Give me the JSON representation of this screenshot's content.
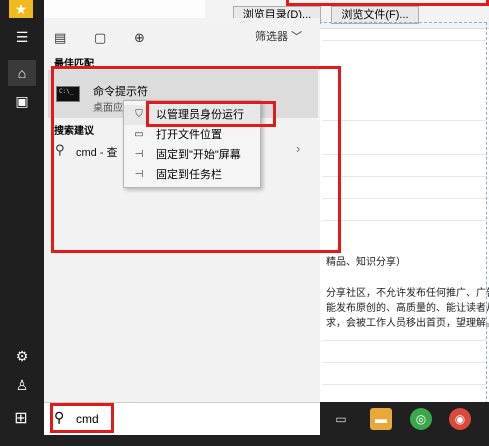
{
  "background": {
    "buttons": [
      "浏览目录(D)...",
      "浏览文件(F)..."
    ],
    "text_lines": [
      "精品、知识分享）",
      "分享社区，不允许发布任何推广、广告、",
      "能发布原创的、高质量的、能让读者从",
      "求，会被工作人员移出首页，望理解。如"
    ]
  },
  "panel": {
    "filter_label": "筛选器",
    "best_match_label": "最佳匹配",
    "best_match": {
      "title": "命令提示符",
      "subtitle": "桌面应用",
      "icon_text": "C:\\_"
    },
    "web_label": "搜索建议",
    "web_suggestion": "cmd - 查"
  },
  "context_menu": {
    "items": [
      {
        "label": "以管理员身份运行",
        "icon": "shield-icon"
      },
      {
        "label": "打开文件位置",
        "icon": "folder-icon"
      },
      {
        "label": "固定到\"开始\"屏幕",
        "icon": "pin-icon"
      },
      {
        "label": "固定到任务栏",
        "icon": "pin-icon"
      }
    ]
  },
  "search": {
    "value": "cmd"
  },
  "colors": {
    "annotation": "#e21a1a",
    "taskbar": "#202020",
    "panel": "#f2f2f2"
  }
}
